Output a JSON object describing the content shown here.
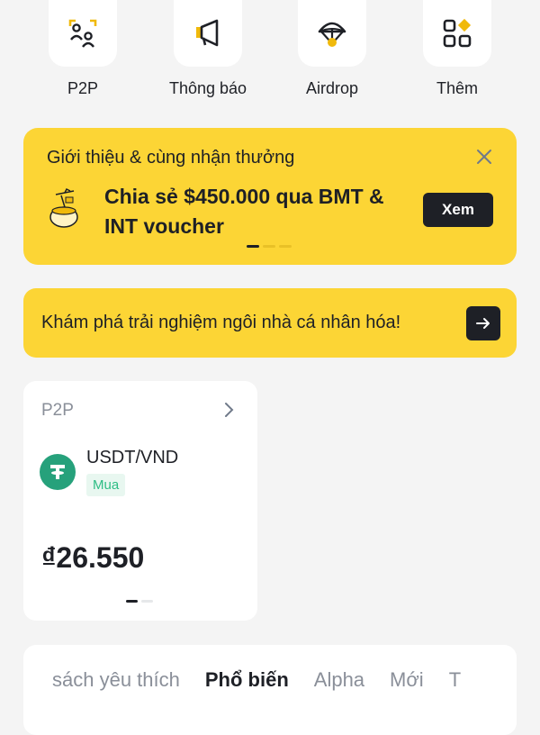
{
  "quick_actions": [
    {
      "label": "P2P",
      "icon": "p2p-people-icon"
    },
    {
      "label": "Thông báo",
      "icon": "megaphone-icon"
    },
    {
      "label": "Airdrop",
      "icon": "parachute-icon"
    },
    {
      "label": "Thêm",
      "icon": "more-grid-icon"
    }
  ],
  "promo": {
    "title": "Giới thiệu & cùng nhận thưởng",
    "headline": "Chia sẻ $450.000 qua BMT & INT voucher",
    "button": "Xem",
    "slide_index": 1,
    "slide_count": 3
  },
  "explore_banner": {
    "text": "Khám phá trải nghiệm ngôi nhà cá nhân hóa!"
  },
  "p2p_card": {
    "title": "P2P",
    "pair": "USDT/VND",
    "side": "Mua",
    "price": "₫26.550",
    "slide_index": 1,
    "slide_count": 2
  },
  "market_tabs": {
    "items": [
      "sách yêu thích",
      "Phổ biến",
      "Alpha",
      "Mới",
      "T"
    ],
    "active": "Phổ biến"
  },
  "colors": {
    "brand_yellow": "#fcd535",
    "dark": "#1e2026",
    "green": "#2ebd85",
    "tether": "#26a17b"
  }
}
